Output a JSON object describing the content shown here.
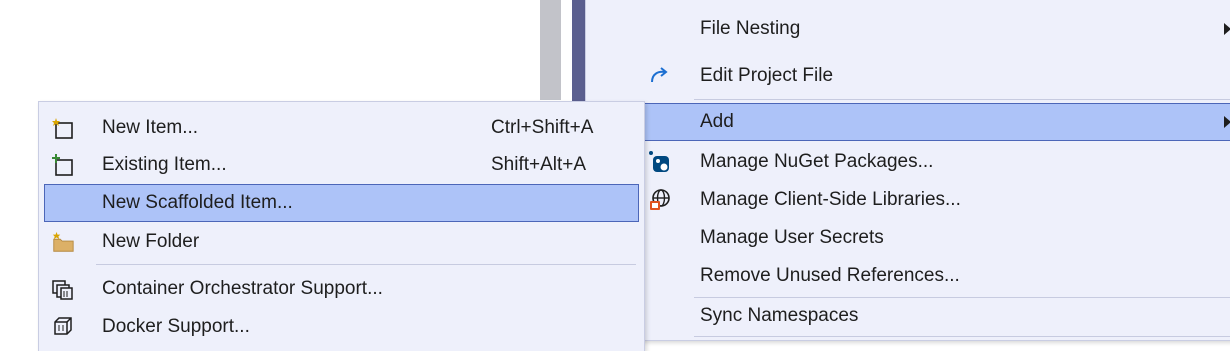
{
  "context_menu": {
    "items": [
      {
        "label": "File Nesting",
        "icon": "none",
        "has_submenu": true
      },
      {
        "label": "Edit Project File",
        "icon": "redo-arrow-icon",
        "has_submenu": false
      },
      {
        "label": "Add",
        "icon": "none",
        "has_submenu": true,
        "highlighted": true
      },
      {
        "label": "Manage NuGet Packages...",
        "icon": "nuget-icon",
        "has_submenu": false
      },
      {
        "label": "Manage Client-Side Libraries...",
        "icon": "client-libraries-icon",
        "has_submenu": false
      },
      {
        "label": "Manage User Secrets",
        "icon": "none",
        "has_submenu": false
      },
      {
        "label": "Remove Unused References...",
        "icon": "none",
        "has_submenu": false
      },
      {
        "label": "Sync Namespaces",
        "icon": "none",
        "has_submenu": false
      }
    ]
  },
  "add_submenu": {
    "items": [
      {
        "label": "New Item...",
        "shortcut": "Ctrl+Shift+A",
        "icon": "new-item-icon"
      },
      {
        "label": "Existing Item...",
        "shortcut": "Shift+Alt+A",
        "icon": "existing-item-icon"
      },
      {
        "label": "New Scaffolded Item...",
        "shortcut": "",
        "icon": "none",
        "highlighted": true
      },
      {
        "label": "New Folder",
        "shortcut": "",
        "icon": "new-folder-icon"
      },
      {
        "label": "Container Orchestrator Support...",
        "shortcut": "",
        "icon": "container-orchestrator-icon"
      },
      {
        "label": "Docker Support...",
        "shortcut": "",
        "icon": "docker-icon"
      }
    ]
  },
  "colors": {
    "menu_background": "#eef0fb",
    "highlight": "#adc3f8",
    "highlight_border": "#4c66b8",
    "accent_blue": "#1c6fd1"
  }
}
